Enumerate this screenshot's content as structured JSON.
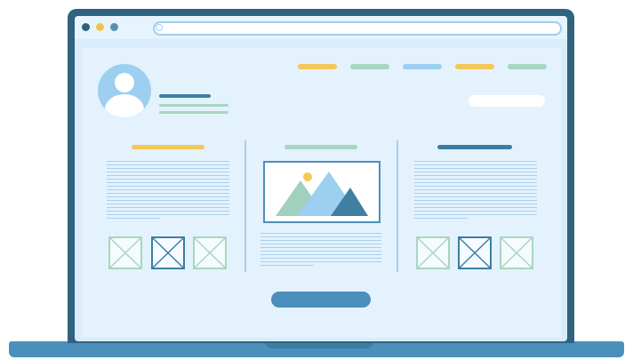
{
  "colors": {
    "frame": "#30637e",
    "screen_bg": "#d9ecfb",
    "page_bg": "#e4f2fd",
    "panel_bg": "#ddeefc",
    "dot_dark": "#2f5f7a",
    "dot_yellow": "#f0c34f",
    "dot_blue": "#5a8fb2",
    "nav_yellow": "#f3c857",
    "nav_green": "#a8d6c0",
    "nav_blue": "#9ccff0",
    "accent_dark": "#3b7ea3",
    "text_line": "#a9d0ee",
    "thumb_border": "#a8d6c0",
    "mountain_green": "#9fd1be",
    "mountain_blue": "#9ccff0",
    "mountain_dark": "#3f7fa1",
    "sun": "#f3c857",
    "button": "#4b8fbc",
    "base": "#4b8fbc"
  },
  "icons": {
    "window_controls": [
      "red-dot",
      "yellow-dot",
      "blue-dot"
    ],
    "address_bar": "search-icon",
    "profile": "avatar-icon",
    "hero": "mountain-image-icon",
    "placeholders": "image-placeholder-icon"
  }
}
